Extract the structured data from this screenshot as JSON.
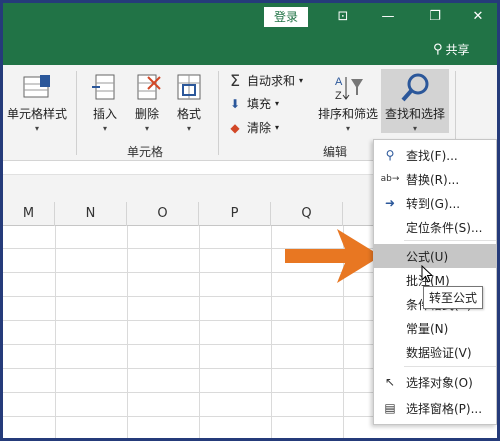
{
  "titlebar": {
    "login_label": "登录",
    "share_label": "共享",
    "accent_color": "#217346"
  },
  "ribbon": {
    "cell_styles_label": "单元格样式",
    "insert_label": "插入",
    "delete_label": "删除",
    "format_label": "格式",
    "cells_group_label": "单元格",
    "autosum_label": "自动求和",
    "fill_label": "填充",
    "clear_label": "清除",
    "sort_filter_label": "排序和筛选",
    "find_select_label": "查找和选择",
    "editing_group_label": "编辑"
  },
  "columns": [
    "M",
    "N",
    "O",
    "P",
    "Q"
  ],
  "menu": {
    "items": [
      {
        "label": "查找(F)...",
        "icon": "search-icon"
      },
      {
        "label": "替换(R)...",
        "icon": "replace-icon"
      },
      {
        "label": "转到(G)...",
        "icon": "arrow-right-icon"
      },
      {
        "label": "定位条件(S)...",
        "icon": ""
      },
      {
        "label": "公式(U)",
        "icon": "",
        "highlighted": true
      },
      {
        "label": "批注(M)",
        "icon": ""
      },
      {
        "label": "条件格式(C)",
        "icon": ""
      },
      {
        "label": "常量(N)",
        "icon": ""
      },
      {
        "label": "数据验证(V)",
        "icon": ""
      },
      {
        "label": "选择对象(O)",
        "icon": "pointer-icon"
      },
      {
        "label": "选择窗格(P)...",
        "icon": "selection-pane-icon"
      }
    ]
  },
  "tooltip": {
    "text": "转至公式"
  },
  "annotation": {
    "arrow_color": "#e87722"
  }
}
